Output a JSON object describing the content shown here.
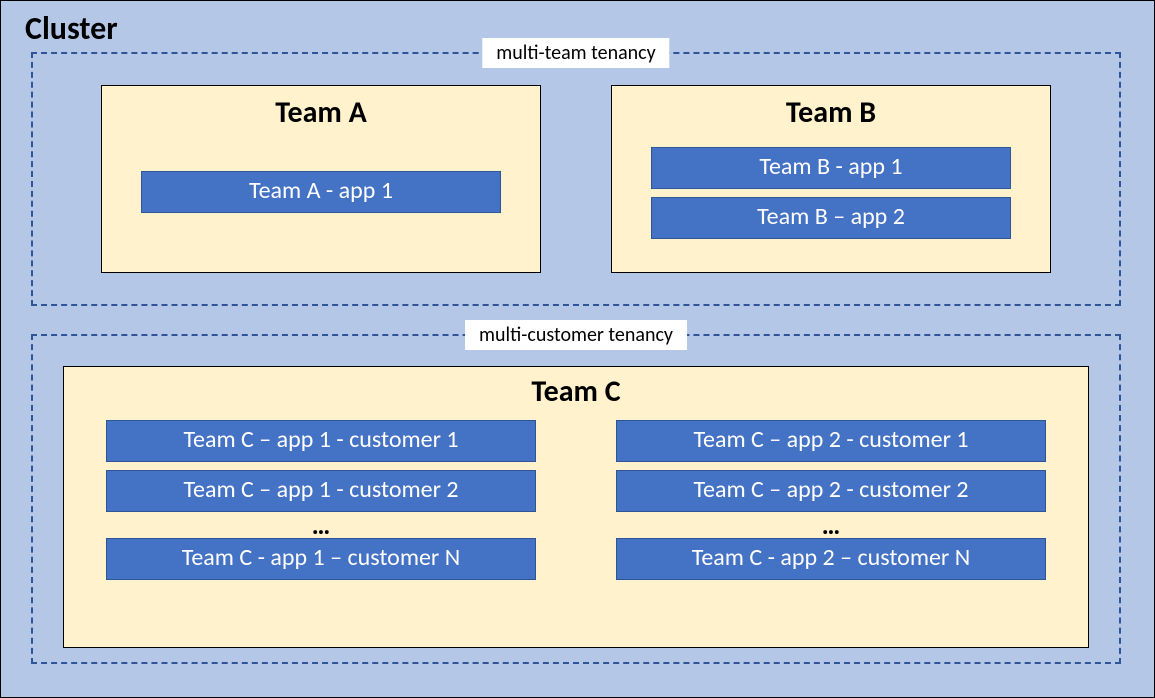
{
  "cluster": {
    "title": "Cluster"
  },
  "tenancy": {
    "team_label": "multi-team tenancy",
    "customer_label": "multi-customer tenancy"
  },
  "teams": {
    "a": {
      "title": "Team A",
      "apps": [
        "Team A - app 1"
      ]
    },
    "b": {
      "title": "Team B",
      "apps": [
        "Team B - app 1",
        "Team B – app 2"
      ]
    },
    "c": {
      "title": "Team C",
      "col1": [
        "Team C – app 1 - customer 1",
        "Team C – app 1 - customer 2",
        "Team C - app 1 – customer N"
      ],
      "col2": [
        "Team C – app 2 - customer 1",
        "Team C – app 2 - customer 2",
        "Team C - app 2 – customer N"
      ],
      "ellipsis": "…"
    }
  }
}
